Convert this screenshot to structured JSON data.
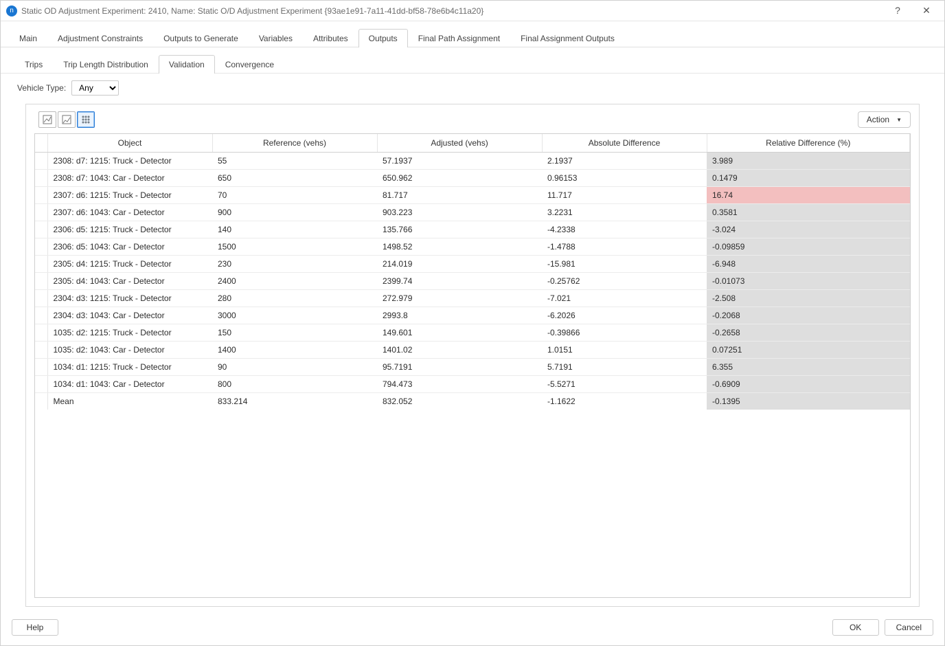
{
  "window": {
    "title": "Static OD Adjustment Experiment: 2410, Name: Static O/D Adjustment Experiment  {93ae1e91-7a11-41dd-bf58-78e6b4c11a20}"
  },
  "main_tabs": [
    {
      "label": "Main"
    },
    {
      "label": "Adjustment Constraints"
    },
    {
      "label": "Outputs to Generate"
    },
    {
      "label": "Variables"
    },
    {
      "label": "Attributes"
    },
    {
      "label": "Outputs",
      "active": true
    },
    {
      "label": "Final Path Assignment"
    },
    {
      "label": "Final Assignment Outputs"
    }
  ],
  "sub_tabs": [
    {
      "label": "Trips"
    },
    {
      "label": "Trip Length Distribution"
    },
    {
      "label": "Validation",
      "active": true
    },
    {
      "label": "Convergence"
    }
  ],
  "filter": {
    "vehicle_type_label": "Vehicle Type:",
    "vehicle_type_value": "Any"
  },
  "toolbar": {
    "action_label": "Action"
  },
  "table": {
    "columns": {
      "object": "Object",
      "reference": "Reference (vehs)",
      "adjusted": "Adjusted (vehs)",
      "absdiff": "Absolute Difference",
      "reldiff": "Relative Difference (%)"
    },
    "rows": [
      {
        "object": "2308: d7: 1215: Truck - Detector",
        "reference": "55",
        "adjusted": "57.1937",
        "absdiff": "2.1937",
        "reldiff": "3.989"
      },
      {
        "object": "2308: d7: 1043: Car - Detector",
        "reference": "650",
        "adjusted": "650.962",
        "absdiff": "0.96153",
        "reldiff": "0.1479"
      },
      {
        "object": "2307: d6: 1215: Truck - Detector",
        "reference": "70",
        "adjusted": "81.717",
        "absdiff": "11.717",
        "reldiff": "16.74",
        "reldiff_warn": true
      },
      {
        "object": "2307: d6: 1043: Car - Detector",
        "reference": "900",
        "adjusted": "903.223",
        "absdiff": "3.2231",
        "reldiff": "0.3581"
      },
      {
        "object": "2306: d5: 1215: Truck - Detector",
        "reference": "140",
        "adjusted": "135.766",
        "absdiff": "-4.2338",
        "reldiff": "-3.024"
      },
      {
        "object": "2306: d5: 1043: Car - Detector",
        "reference": "1500",
        "adjusted": "1498.52",
        "absdiff": "-1.4788",
        "reldiff": "-0.09859"
      },
      {
        "object": "2305: d4: 1215: Truck - Detector",
        "reference": "230",
        "adjusted": "214.019",
        "absdiff": "-15.981",
        "reldiff": "-6.948"
      },
      {
        "object": "2305: d4: 1043: Car - Detector",
        "reference": "2400",
        "adjusted": "2399.74",
        "absdiff": "-0.25762",
        "reldiff": "-0.01073"
      },
      {
        "object": "2304: d3: 1215: Truck - Detector",
        "reference": "280",
        "adjusted": "272.979",
        "absdiff": "-7.021",
        "reldiff": "-2.508"
      },
      {
        "object": "2304: d3: 1043: Car - Detector",
        "reference": "3000",
        "adjusted": "2993.8",
        "absdiff": "-6.2026",
        "reldiff": "-0.2068"
      },
      {
        "object": "1035: d2: 1215: Truck - Detector",
        "reference": "150",
        "adjusted": "149.601",
        "absdiff": "-0.39866",
        "reldiff": "-0.2658"
      },
      {
        "object": "1035: d2: 1043: Car - Detector",
        "reference": "1400",
        "adjusted": "1401.02",
        "absdiff": "1.0151",
        "reldiff": "0.07251"
      },
      {
        "object": "1034: d1: 1215: Truck - Detector",
        "reference": "90",
        "adjusted": "95.7191",
        "absdiff": "5.7191",
        "reldiff": "6.355"
      },
      {
        "object": "1034: d1: 1043: Car - Detector",
        "reference": "800",
        "adjusted": "794.473",
        "absdiff": "-5.5271",
        "reldiff": "-0.6909"
      }
    ],
    "mean_row": {
      "object": "Mean",
      "reference": "833.214",
      "adjusted": "832.052",
      "absdiff": "-1.1622",
      "reldiff": "-0.1395"
    }
  },
  "footer": {
    "help": "Help",
    "ok": "OK",
    "cancel": "Cancel"
  }
}
